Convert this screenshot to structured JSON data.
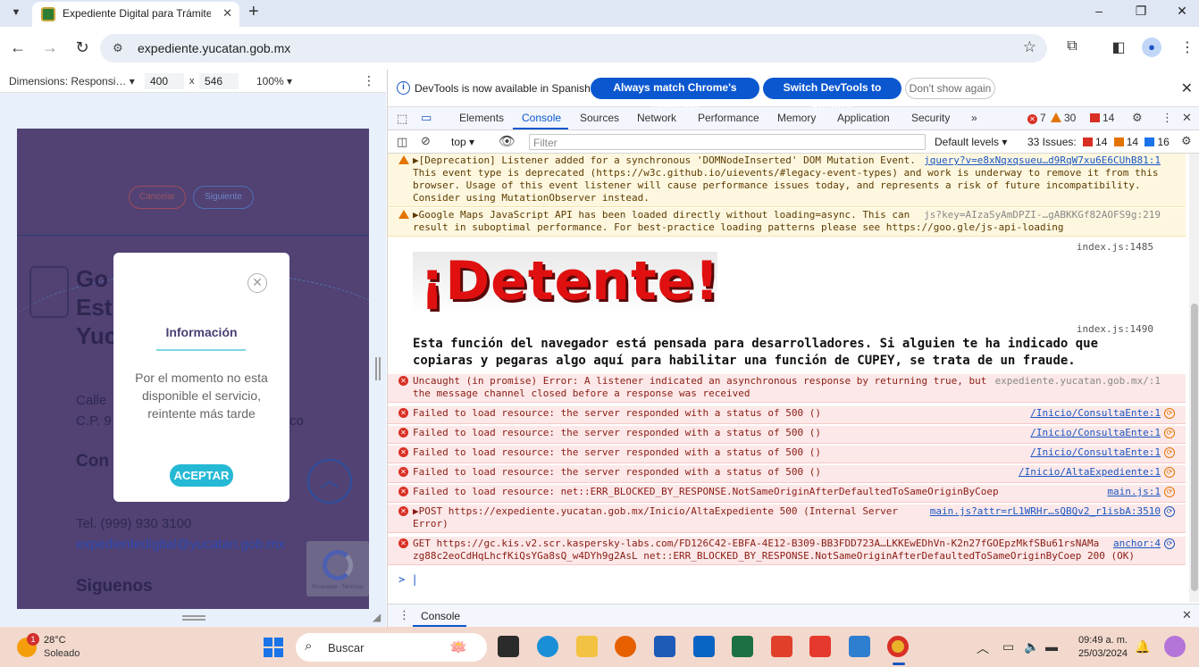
{
  "browser": {
    "tab_title": "Expediente Digital para Trámite",
    "new_tab": "+",
    "url": "expediente.yucatan.gob.mx",
    "window_controls": {
      "minimize": "–",
      "restore": "❐",
      "close": "✕"
    }
  },
  "device_toolbar": {
    "dimensions_label": "Dimensions: Responsi…",
    "width": "400",
    "times": "x",
    "height": "546",
    "zoom": "100%"
  },
  "emulated_page": {
    "cancel_button": "Cancelar",
    "next_button": "Siguiente",
    "title_lines": [
      "Go",
      "Est",
      "Yuc"
    ],
    "address_line1": "Calle",
    "address_line2": "C.P. 9",
    "address_suffix": "co",
    "contact_heading": "Con",
    "phone": "Tel. (999) 930 3100",
    "email": "expedientedigital@yucatan.gob.mx",
    "social_heading": "Siguenos",
    "recaptcha_text": "Privacidad - Términos"
  },
  "modal": {
    "title": "Información",
    "message": "Por el momento no esta disponible el servicio, reintente más tarde",
    "accept": "ACEPTAR"
  },
  "devtools": {
    "info_text": "DevTools is now available in Spanish!",
    "btn_match": "Always match Chrome's language",
    "btn_switch": "Switch DevTools to Spanish",
    "btn_dismiss": "Don't show again",
    "tabs": [
      "Elements",
      "Console",
      "Sources",
      "Network",
      "Performance",
      "Memory",
      "Application",
      "Security"
    ],
    "active_tab": "Console",
    "counts": {
      "errors": "7",
      "warnings": "30",
      "issues": "14"
    },
    "context": "top",
    "filter_placeholder": "Filter",
    "levels": "Default levels",
    "issues_label": "33 Issues:",
    "issues_counts": {
      "red": "14",
      "orange": "14",
      "blue": "16"
    },
    "drawer_tab": "Console"
  },
  "console": {
    "warn1": {
      "text": "▶[Deprecation] Listener added for a synchronous 'DOMNodeInserted' DOM Mutation Event.\nThis event type is deprecated (https://w3c.github.io/uievents/#legacy-event-types) and work is underway to remove it from this\nbrowser. Usage of this event listener will cause performance issues today, and represents a risk of future incompatibility.\nConsider using MutationObserver instead.",
      "source": "jquery?v=e8xNqxqsueu…d9RqW7xu6E6CUhB81:1"
    },
    "warn2": {
      "text": "▶Google Maps JavaScript API has been loaded directly without loading=async. This can\nresult in suboptimal performance. For best-practice loading patterns please see https://goo.gle/js-api-loading",
      "source": "js?key=AIzaSyAmDPZI-…gABKKGf82AOFS9g:219"
    },
    "index1": "index.js:1485",
    "stop_text": "¡Detente!",
    "index2": "index.js:1490",
    "big_message": "Esta función del navegador está pensada para desarrolladores. Si alguien te ha indicado que copiaras y pegaras algo aquí para habilitar una función de CUPEY, se trata de un fraude.",
    "err1": {
      "text": "Uncaught (in promise) Error: A listener indicated an asynchronous response by returning true, but\nthe message channel closed before a response was received",
      "source": "expediente.yucatan.gob.mx/:1"
    },
    "err_rows": [
      {
        "text": "Failed to load resource: the server responded with a status of 500 ()",
        "source": "/Inicio/ConsultaEnte:1"
      },
      {
        "text": "Failed to load resource: the server responded with a status of 500 ()",
        "source": "/Inicio/ConsultaEnte:1"
      },
      {
        "text": "Failed to load resource: the server responded with a status of 500 ()",
        "source": "/Inicio/ConsultaEnte:1"
      },
      {
        "text": "Failed to load resource: the server responded with a status of 500 ()",
        "source": "/Inicio/AltaExpediente:1"
      },
      {
        "text": "Failed to load resource: net::ERR_BLOCKED_BY_RESPONSE.NotSameOriginAfterDefaultedToSameOriginByCoep",
        "source": "main.js:1"
      }
    ],
    "err_post": {
      "text": "▶POST https://expediente.yucatan.gob.mx/Inicio/AltaExpediente 500 (Internal Server\nError)",
      "source": "main.js?attr=rL1WRHr…sQBQv2_r1isbA:3510"
    },
    "err_get": {
      "text": "GET https://gc.kis.v2.scr.kaspersky-labs.com/FD126C42-EBFA-4E12-B309-BB3FDD723A…LKKEwEDhVn-K2n27fGOEpzMkfSBu61rsNAMa\nzg88c2eoCdHqLhcfKiQsYGa8sQ_w4DYh9g2AsL net::ERR_BLOCKED_BY_RESPONSE.NotSameOriginAfterDefaultedToSameOriginByCoep 200 (OK)",
      "source": "anchor:4"
    },
    "prompt": "> |"
  },
  "taskbar": {
    "weather_badge": "1",
    "temperature": "28°C",
    "condition": "Soleado",
    "search_label": "Buscar",
    "time": "09:49 a. m.",
    "date": "25/03/2024"
  },
  "colors": {
    "devtools_accent": "#0b57d0",
    "emulated_bg": "#514273",
    "modal_button": "#25b9d5",
    "taskbar_bg": "#f3d9cd"
  }
}
